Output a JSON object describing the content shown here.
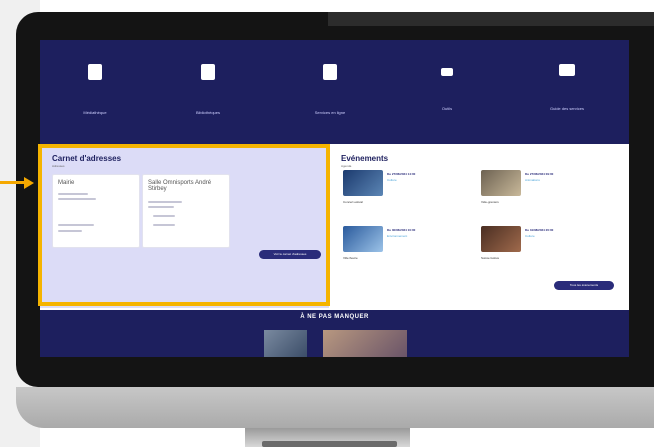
{
  "nav": {
    "items": [
      {
        "label": "Médiathèque",
        "icon": "book-icon"
      },
      {
        "label": "Bibliothèques",
        "icon": "medical-kit-icon"
      },
      {
        "label": "Services en ligne",
        "icon": "bag-icon"
      },
      {
        "label": "Outils",
        "icon": "tools-icon"
      },
      {
        "label": "Guide des services",
        "icon": "open-book-icon"
      }
    ]
  },
  "address_book": {
    "title": "Carnet d'adresses",
    "subtitle": "Adresses",
    "card1": {
      "title": "Mairie",
      "lines": [
        "Coordonnées",
        "Horaires"
      ]
    },
    "card2": {
      "title": "Salle Omnisports André Stirbey",
      "lines": [
        "Rue des Sports",
        "Nous contacter",
        "Nous contacter"
      ]
    },
    "button": "Voir le carnet d'adresses"
  },
  "events": {
    "title": "Evénements",
    "subtitle": "Agenda",
    "items": [
      {
        "title": "Concert estival",
        "date": "Du 27/06/2024 14:00",
        "tag": "Culture"
      },
      {
        "title": "Vide-greniers",
        "date": "Du 27/06/2024 09:00",
        "tag": "Animations"
      },
      {
        "title": "Ville fleurie",
        "date": "Du 30/06/2024 10:00",
        "tag": "Environnement"
      },
      {
        "title": "Soirée festive",
        "date": "Du 31/08/2024 20:00",
        "tag": "Culture"
      }
    ],
    "button": "Tous les événements"
  },
  "bottom": {
    "title": "À NE PAS MANQUER"
  }
}
